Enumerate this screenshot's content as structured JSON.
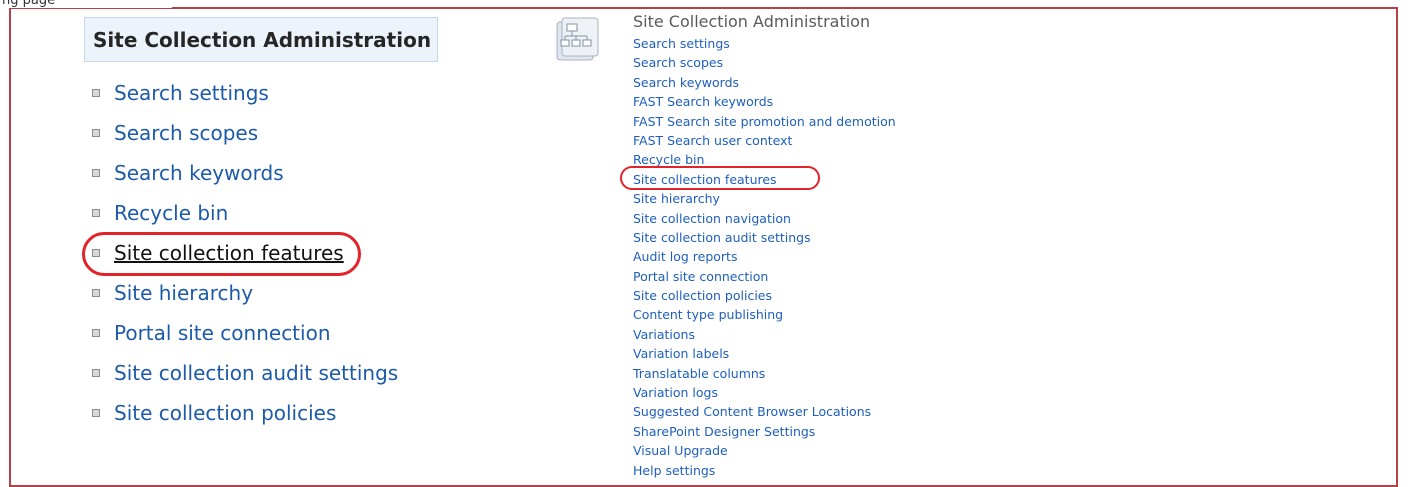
{
  "top_fragment": "ng page",
  "left_panel": {
    "header": "Site Collection Administration",
    "items": [
      {
        "label": "Search settings"
      },
      {
        "label": "Search scopes"
      },
      {
        "label": "Search keywords"
      },
      {
        "label": "Recycle bin"
      },
      {
        "label": "Site collection features"
      },
      {
        "label": "Site hierarchy"
      },
      {
        "label": "Portal site connection"
      },
      {
        "label": "Site collection audit settings"
      },
      {
        "label": "Site collection policies"
      }
    ]
  },
  "right_panel": {
    "icon": "site-collection-icon",
    "title": "Site Collection Administration",
    "links": [
      "Search settings",
      "Search scopes",
      "Search keywords",
      "FAST Search keywords",
      "FAST Search site promotion and demotion",
      "FAST Search user context",
      "Recycle bin",
      "Site collection features",
      "Site hierarchy",
      "Site collection navigation",
      "Site collection audit settings",
      "Audit log reports",
      "Portal site connection",
      "Site collection policies",
      "Content type publishing",
      "Variations",
      "Variation labels",
      "Translatable columns",
      "Variation logs",
      "Suggested Content Browser Locations",
      "SharePoint Designer Settings",
      "Visual Upgrade",
      "Help settings"
    ]
  },
  "colors": {
    "frame": "#b6404a",
    "highlight_circle": "#e2232a",
    "link": "#1e5fbd",
    "header_bg": "#edf3fb"
  }
}
